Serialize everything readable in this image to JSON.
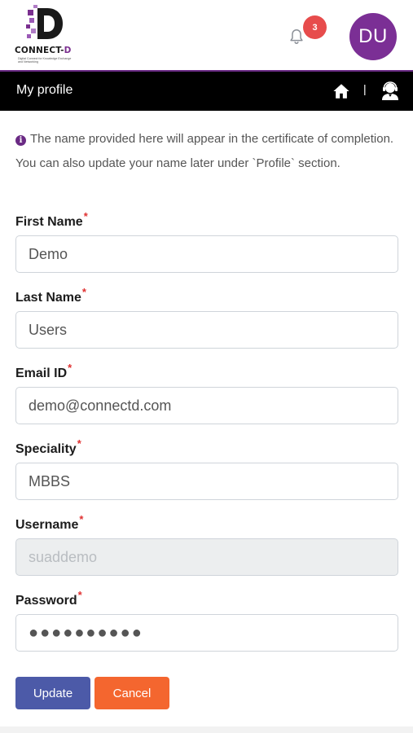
{
  "brand": {
    "name_main": "CONNECT-",
    "name_accent": "D",
    "tagline": "Digital Connect for Knowledge Exchange and Networking"
  },
  "header": {
    "notification_count": "3",
    "avatar_initials": "DU"
  },
  "navbar": {
    "title": "My profile",
    "divider": "|"
  },
  "notice": {
    "icon": "i",
    "text": "The name provided here will appear in the certificate of completion. You can also update your name later under `Profile` section."
  },
  "form": {
    "required_mark": "*",
    "first_name": {
      "label": "First Name",
      "value": "Demo"
    },
    "last_name": {
      "label": "Last Name",
      "value": "Users"
    },
    "email": {
      "label": "Email ID",
      "value": "demo@connectd.com"
    },
    "speciality": {
      "label": "Speciality",
      "value": "MBBS"
    },
    "username": {
      "label": "Username",
      "value": "suaddemo"
    },
    "password": {
      "label": "Password",
      "value": "●●●●●●●●●●"
    }
  },
  "actions": {
    "update_label": "Update",
    "cancel_label": "Cancel"
  },
  "colors": {
    "brand_purple": "#7b2f95",
    "navbar_bg": "#000000",
    "badge_red": "#e74c4c",
    "update_blue": "#4c5aa8",
    "cancel_orange": "#f4662f",
    "required_red": "#e03131"
  },
  "icons": [
    "connect-d-logo",
    "bell-icon",
    "home-icon",
    "support-agent-icon",
    "info-icon"
  ]
}
